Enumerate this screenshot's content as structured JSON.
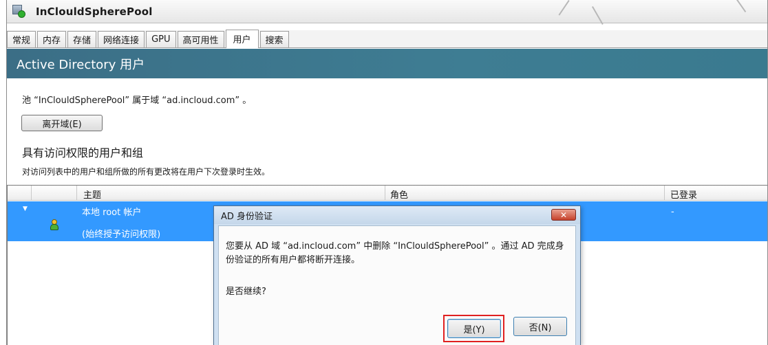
{
  "window": {
    "title": "InClouldSpherePool"
  },
  "tabs": [
    "常规",
    "内存",
    "存储",
    "网络连接",
    "GPU",
    "高可用性",
    "用户",
    "搜索"
  ],
  "active_tab_index": 6,
  "section": {
    "header": "Active Directory 用户",
    "domain_text": "池 “InClouldSpherePool” 属于域 “ad.incloud.com” 。",
    "leave_button": "离开域(E)",
    "subheading": "具有访问权限的用户和组",
    "note": "对访问列表中的用户和组所做的所有更改将在用户下次登录时生效。"
  },
  "grid": {
    "columns": [
      "主题",
      "角色",
      "已登录"
    ],
    "rows": [
      {
        "expander": "▼",
        "subject_line1": "本地 root 帐户",
        "subject_line2": "(始终授予访问权限)",
        "logged_in": "-"
      }
    ]
  },
  "dialog": {
    "title": "AD 身份验证",
    "close_glyph": "✕",
    "message": "您要从 AD 域 “ad.incloud.com” 中删除 “InClouldSpherePool” 。通过 AD 完成身份验证的所有用户都将断开连接。",
    "question": "是否继续?",
    "yes_button": "是(Y)",
    "no_button": "否(N)"
  },
  "colors": {
    "header_bg": "#3b6e86",
    "selection": "#3399ff",
    "highlight_box": "#e02020"
  }
}
